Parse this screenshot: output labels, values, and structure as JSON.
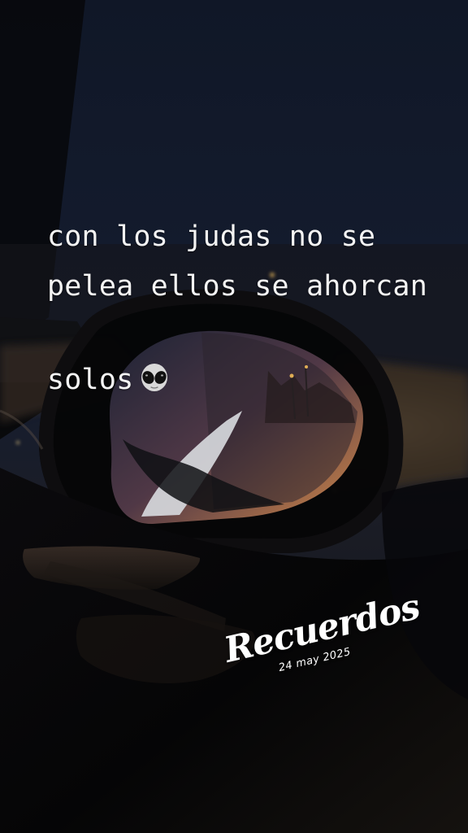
{
  "caption": {
    "text": "con los judas no se\npelea ellos se ahorcan\nsolos",
    "emoji": "alien-icon"
  },
  "sticker": {
    "title": "Recuerdos",
    "date": "24 may 2025"
  },
  "colors": {
    "night_sky": "#111827",
    "sunset_orange": "#d78a45",
    "text": "#f4f4f4"
  }
}
